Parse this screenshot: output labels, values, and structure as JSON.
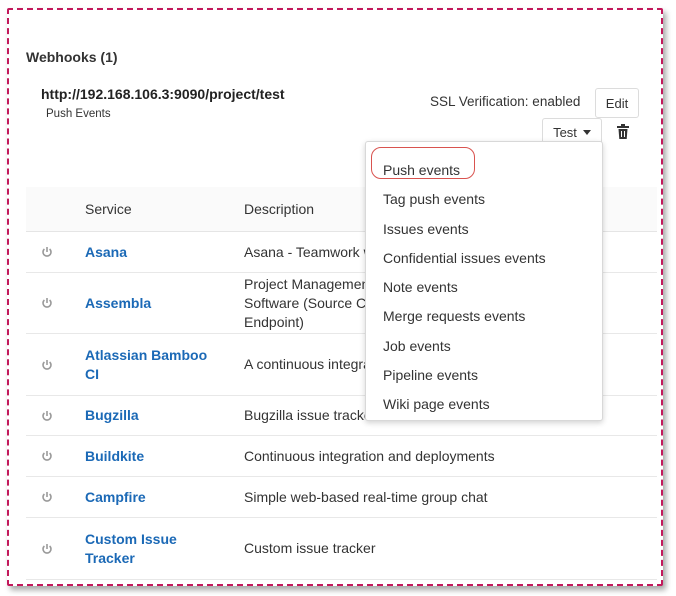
{
  "webhooks": {
    "title": "Webhooks (1)",
    "url": "http://192.168.106.3:9090/project/test",
    "events": "Push Events",
    "ssl": "SSL Verification: enabled",
    "edit_label": "Edit",
    "test_label": "Test"
  },
  "table": {
    "headers": {
      "service": "Service",
      "description": "Description"
    },
    "rows": [
      {
        "name": "Asana",
        "desc": "Asana - Teamwork without email"
      },
      {
        "name": "Assembla",
        "desc": "Project Management Software (Source Commits Endpoint)"
      },
      {
        "name": "Atlassian Bamboo CI",
        "desc": "A continuous integration and build server"
      },
      {
        "name": "Bugzilla",
        "desc": "Bugzilla issue tracker"
      },
      {
        "name": "Buildkite",
        "desc": "Continuous integration and deployments"
      },
      {
        "name": "Campfire",
        "desc": "Simple web-based real-time group chat"
      },
      {
        "name": "Custom Issue Tracker",
        "desc": "Custom issue tracker"
      }
    ]
  },
  "dropdown": {
    "items": [
      "Push events",
      "Tag push events",
      "Issues events",
      "Confidential issues events",
      "Note events",
      "Merge requests events",
      "Job events",
      "Pipeline events",
      "Wiki page events"
    ],
    "highlighted_index": 0
  },
  "colors": {
    "link": "#1b69b6",
    "frame_border": "#c2185b",
    "highlight_ring": "#d9534f"
  }
}
